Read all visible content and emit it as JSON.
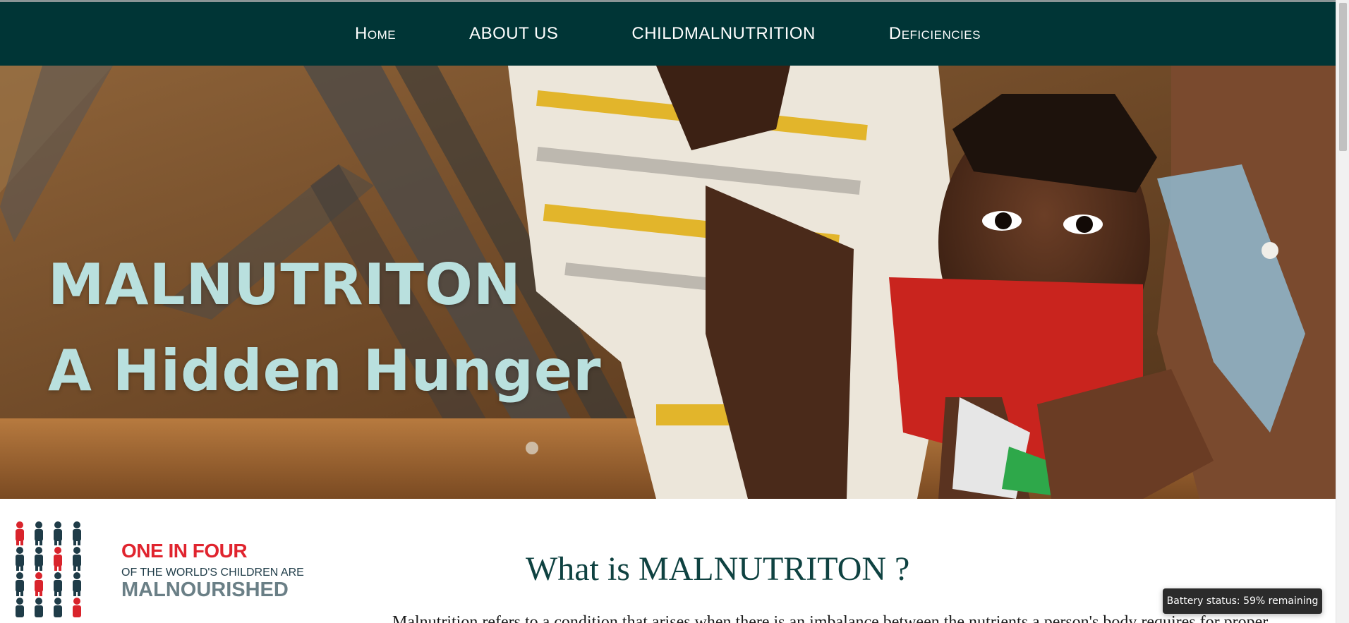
{
  "nav": {
    "items": [
      {
        "label": "Home"
      },
      {
        "label": "ABOUT US"
      },
      {
        "label": "CHILDMALNUTRITION"
      },
      {
        "label": "Deficiencies"
      }
    ]
  },
  "hero": {
    "title_line1": "MALNUTRITON",
    "title_line2": "A Hidden Hunger",
    "image": "child-nutrition-measurement-photo"
  },
  "poster": {
    "line1": "ONE IN FOUR",
    "line2": "OF THE WORLD'S CHILDREN ARE",
    "line3": "MALNOURISHED",
    "icon": "child-figures-grid-icon"
  },
  "main": {
    "heading": "What is MALNUTRITON ?",
    "body_text": "Malnutrition refers to a condition that arises when there is an imbalance between the nutrients a person's body requires for proper"
  },
  "status": {
    "battery": "Battery status: 59% remaining"
  },
  "colors": {
    "navbar": "#003536",
    "hero_title": "#b9e0de",
    "heading": "#0f4241",
    "poster_red": "#e0242e",
    "poster_navy": "#1f3c48"
  }
}
